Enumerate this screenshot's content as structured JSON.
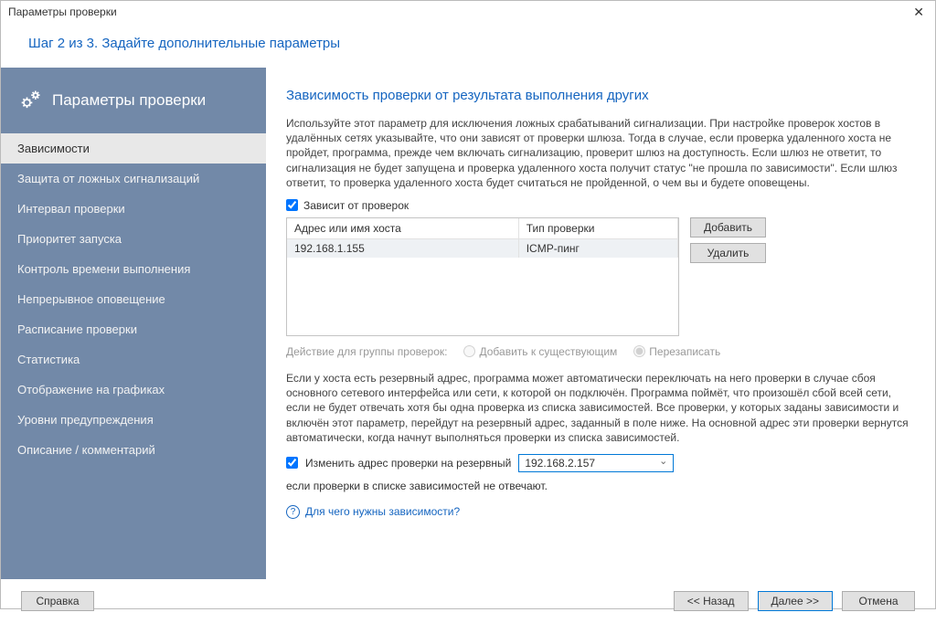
{
  "window": {
    "title": "Параметры проверки"
  },
  "step_header": "Шаг 2 из 3. Задайте дополнительные параметры",
  "sidebar": {
    "title": "Параметры проверки",
    "items": [
      {
        "label": "Зависимости",
        "active": true
      },
      {
        "label": "Защита от ложных сигнализаций"
      },
      {
        "label": "Интервал проверки"
      },
      {
        "label": "Приоритет запуска"
      },
      {
        "label": "Контроль времени выполнения"
      },
      {
        "label": "Непрерывное оповещение"
      },
      {
        "label": "Расписание проверки"
      },
      {
        "label": "Статистика"
      },
      {
        "label": "Отображение на графиках"
      },
      {
        "label": "Уровни предупреждения"
      },
      {
        "label": "Описание / комментарий"
      }
    ]
  },
  "content": {
    "heading": "Зависимость проверки от результата выполнения других",
    "intro": "Используйте этот параметр для исключения ложных срабатываний сигнализации. При настройке проверок хостов в удалённых сетях указывайте, что они зависят от проверки шлюза. Тогда в случае, если проверка удаленного хоста не пройдет, программа, прежде чем включать сигнализацию, проверит шлюз на доступность. Если шлюз не ответит, то сигнализация не будет запущена и проверка удаленного хоста получит статус \"не прошла по зависимости\". Если шлюз ответит, то проверка удаленного хоста будет считаться не пройденной, о чем вы и будете оповещены.",
    "depends_checkbox": "Зависит от проверок",
    "table": {
      "col1": "Адрес или имя хоста",
      "col2": "Тип проверки",
      "rows": [
        {
          "host": "192.168.1.155",
          "type": "ICMP-пинг"
        }
      ]
    },
    "btn_add": "Добавить",
    "btn_delete": "Удалить",
    "group_action": {
      "label": "Действие для группы проверок:",
      "opt_append": "Добавить к существующим",
      "opt_overwrite": "Перезаписать"
    },
    "reserve_text": "Если у хоста есть резервный адрес, программа может автоматически переключать на него проверки в случае сбоя основного сетевого интерфейса или сети, к которой он подключён. Программа поймёт, что произошёл сбой всей сети, если не будет отвечать хотя бы одна проверка из списка зависимостей. Все проверки, у которых заданы зависимости и включён этот параметр, перейдут на резервный адрес, заданный в поле ниже. На основной адрес эти проверки вернутся автоматически, когда начнут выполняться проверки из списка зависимостей.",
    "reserve_checkbox": "Изменить адрес проверки на резервный",
    "reserve_value": "192.168.2.157",
    "reserve_suffix": "если проверки в списке зависимостей не отвечают.",
    "help_link": "Для чего нужны зависимости?"
  },
  "footer": {
    "help": "Справка",
    "back": "<< Назад",
    "next": "Далее >>",
    "cancel": "Отмена"
  }
}
